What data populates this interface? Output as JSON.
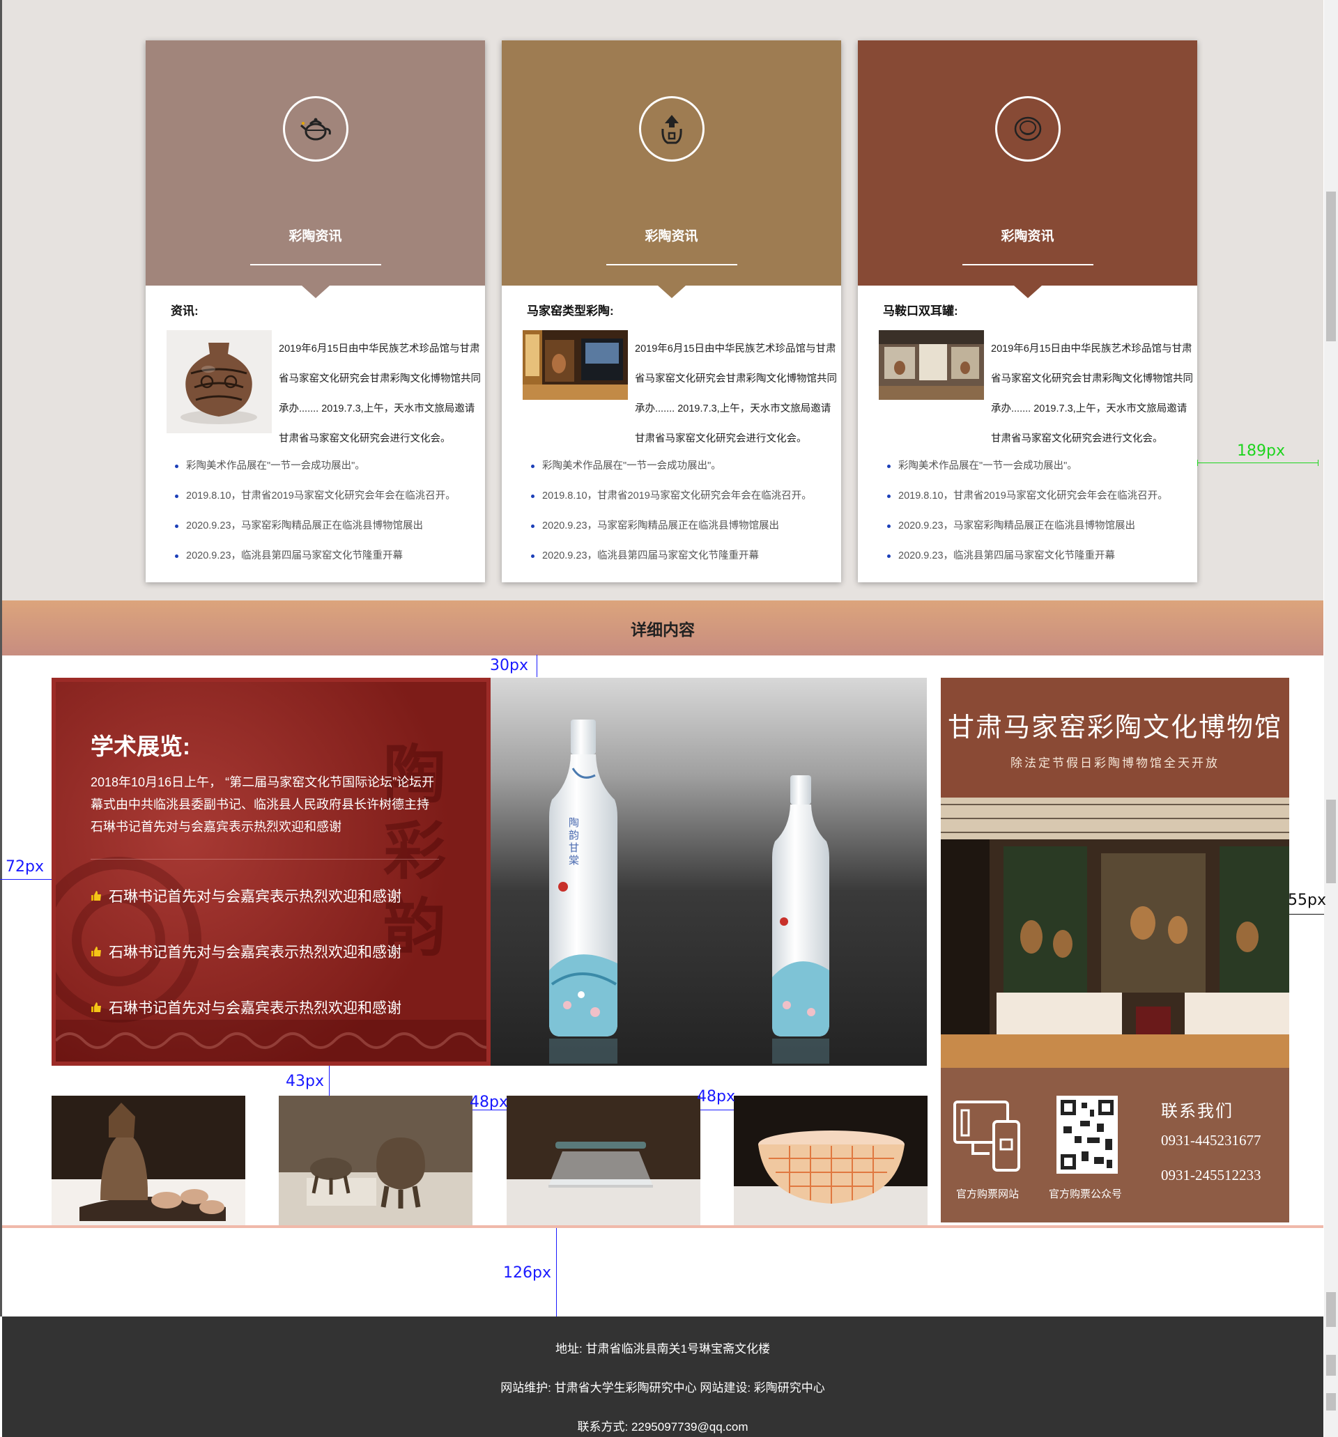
{
  "cards": [
    {
      "header_color": "#a1857b",
      "title": "彩陶资讯",
      "subtitle": "资讯:",
      "icon": "teapot-icon",
      "desc": "2019年6月15日由中华民族艺术珍品馆与甘肃省马家窑文化研究会甘肃彩陶文化博物馆共同承办....... 2019.7.3,上午，天水市文旅局邀请甘肃省马家窑文化研究会进行文化会。",
      "list": [
        "彩陶美术作品展在\"一节一会成功展出\"。",
        "2019.8.10，甘肃省2019马家窑文化研究会年会在临洮召开。",
        "2020.9.23，马家窑彩陶精品展正在临洮县博物馆展出",
        "2020.9.23，临洮县第四届马家窑文化节隆重开幕"
      ]
    },
    {
      "header_color": "#9e7c52",
      "title": "彩陶资讯",
      "subtitle": "马家窑类型彩陶:",
      "icon": "pottery-icon",
      "desc": "2019年6月15日由中华民族艺术珍品馆与甘肃省马家窑文化研究会甘肃彩陶文化博物馆共同承办....... 2019.7.3,上午，天水市文旅局邀请甘肃省马家窑文化研究会进行文化会。",
      "list": [
        "彩陶美术作品展在\"一节一会成功展出\"。",
        "2019.8.10，甘肃省2019马家窑文化研究会年会在临洮召开。",
        "2020.9.23，马家窑彩陶精品展正在临洮县博物馆展出",
        "2020.9.23，临洮县第四届马家窑文化节隆重开幕"
      ]
    },
    {
      "header_color": "#874a35",
      "title": "彩陶资讯",
      "subtitle": "马鞍口双耳罐:",
      "icon": "bowl-icon",
      "desc": "2019年6月15日由中华民族艺术珍品馆与甘肃省马家窑文化研究会甘肃彩陶文化博物馆共同承办....... 2019.7.3,上午，天水市文旅局邀请甘肃省马家窑文化研究会进行文化会。",
      "list": [
        "彩陶美术作品展在\"一节一会成功展出\"。",
        "2019.8.10，甘肃省2019马家窑文化研究会年会在临洮召开。",
        "2020.9.23，马家窑彩陶精品展正在临洮县博物馆展出",
        "2020.9.23，临洮县第四届马家窑文化节隆重开幕"
      ]
    }
  ],
  "detail": {
    "title": "详细内容"
  },
  "banner": {
    "title": "学术展览:",
    "text": "2018年10月16日上午， “第二届马家窑文化节国际论坛”论坛开幕式由中共临洮县委副书记、临洮县人民政府县长许树德主持 石琳书记首先对与会嘉宾表示热烈欢迎和感谢",
    "items": [
      "石琳书记首先对与会嘉宾表示热烈欢迎和感谢",
      "石琳书记首先对与会嘉宾表示热烈欢迎和感谢",
      "石琳书记首先对与会嘉宾表示热烈欢迎和感谢"
    ],
    "bg_chars": [
      "陶",
      "彩",
      "韵"
    ],
    "bottle_label": "陶韵甘棠"
  },
  "poster": {
    "title": "甘肃马家窑彩陶文化博物馆",
    "subtitle": "除法定节假日彩陶博物馆全天开放",
    "label_site": "官方购票网站",
    "label_wechat": "官方购票公众号",
    "contact_title": "联系我们",
    "phone1": "0931-445231677",
    "phone2": "0931-245512233"
  },
  "footer": {
    "address": "地址: 甘肃省临洮县南关1号琳宝斋文化楼",
    "maintain": "网站维护: 甘肃省大学生彩陶研究中心 网站建设: 彩陶研究中心",
    "contact": "联系方式: 2295097739@qq.com"
  },
  "annotations": {
    "a189": "189px",
    "a30": "30px",
    "a72": "72px",
    "a55": "55px",
    "a43": "43px",
    "a48a": "48px",
    "a48b": "48px",
    "a126": "126px"
  }
}
